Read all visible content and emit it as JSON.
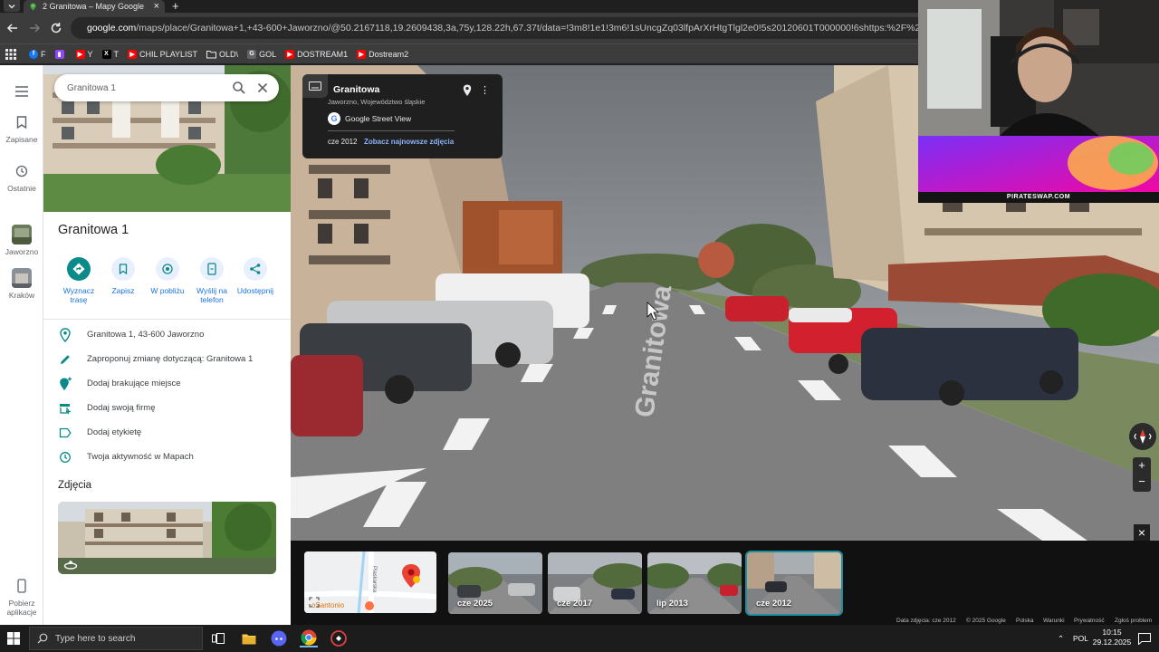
{
  "browser": {
    "tab_title": "2 Granitowa – Mapy Google",
    "tab_close": "×",
    "new_tab": "+",
    "url_host": "google.com",
    "url_path": "/maps/place/Granitowa+1,+43-600+Jaworzno/@50.2167118,19.2609438,3a,75y,128.22h,67.37t/data=!3m8!1e1!3m6!1sUncgZq03lfpArXrHtgTlgl2e0!5s20120601T000000!6shttps:%2F%2Fstreetviewpixels-pa.go",
    "bookmarks": [
      {
        "label": "F",
        "icon": "facebook-icon",
        "color": "#1877f2"
      },
      {
        "label": "",
        "icon": "twitch-icon",
        "color": "#9146ff"
      },
      {
        "label": "Y",
        "icon": "youtube-icon",
        "color": "#ff0000"
      },
      {
        "label": "T",
        "icon": "x-icon",
        "color": "#000000"
      },
      {
        "label": "CHIL PLAYLIST",
        "icon": "youtube-icon",
        "color": "#ff0000"
      },
      {
        "label": "OLD\\",
        "icon": "folder-icon",
        "color": "#9aa0a6"
      },
      {
        "label": "GOL",
        "icon": "g-icon",
        "color": "#5f6368"
      },
      {
        "label": "DOSTREAM1",
        "icon": "youtube-icon",
        "color": "#ff0000"
      },
      {
        "label": "Dostream2",
        "icon": "youtube-icon",
        "color": "#ff0000"
      }
    ]
  },
  "rail": {
    "saved": "Zapisane",
    "recent": "Ostatnie",
    "jaworzno": "Jaworzno",
    "krakow": "Kraków",
    "get_app": "Pobierz aplikacje"
  },
  "panel": {
    "search_value": "Granitowa 1",
    "title": "Granitowa 1",
    "actions": [
      {
        "label": "Wyznacz trasę",
        "icon": "directions-icon"
      },
      {
        "label": "Zapisz",
        "icon": "bookmark-icon"
      },
      {
        "label": "W pobliżu",
        "icon": "nearby-icon"
      },
      {
        "label": "Wyślij na telefon",
        "icon": "phone-icon"
      },
      {
        "label": "Udostępnij",
        "icon": "share-icon"
      }
    ],
    "info": [
      {
        "text": "Granitowa 1, 43-600 Jaworzno",
        "icon": "location-pin-icon"
      },
      {
        "text": "Zaproponuj zmianę dotyczącą: Granitowa 1",
        "icon": "pencil-icon"
      },
      {
        "text": "Dodaj brakujące miejsce",
        "icon": "add-place-icon"
      },
      {
        "text": "Dodaj swoją firmę",
        "icon": "store-icon"
      },
      {
        "text": "Dodaj etykietę",
        "icon": "label-icon"
      },
      {
        "text": "Twoja aktywność w Mapach",
        "icon": "history-icon"
      }
    ],
    "photos_title": "Zdjęcia"
  },
  "streetview": {
    "card_title": "Granitowa",
    "card_subtitle": "Jaworzno, Województwo śląskie",
    "brand": "Google Street View",
    "date": "cze 2012",
    "newer_link": "Zobacz najnowsze zdjęcia",
    "road_text": "Granitowa",
    "zoom_in": "+",
    "zoom_out": "−",
    "close": "×"
  },
  "overlay": {
    "ad_text": "PIRATESWAP.COM"
  },
  "filmstrip": {
    "thumbs": [
      {
        "label": "cze 2025"
      },
      {
        "label": "cze 2017"
      },
      {
        "label": "lip 2013"
      },
      {
        "label": "cze 2012"
      }
    ],
    "map_labels": [
      "Piaskarska",
      "oSantonio"
    ],
    "legal": {
      "date": "Data zdjęcia: cze 2012",
      "copyright": "© 2025 Google",
      "country": "Polska",
      "terms": "Warunki",
      "privacy": "Prywatność",
      "report": "Zgłoś problem"
    }
  },
  "taskbar": {
    "search_placeholder": "Type here to search",
    "lang": "POL",
    "time": "10:15",
    "date": "29.12.2025"
  }
}
